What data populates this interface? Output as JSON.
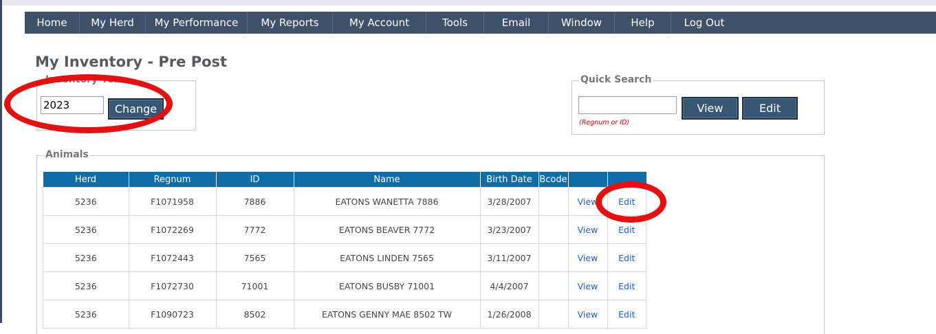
{
  "nav": {
    "items": [
      "Home",
      "My Herd",
      "My Performance",
      "My Reports",
      "My Account",
      "Tools",
      "Email",
      "Window",
      "Help",
      "Log Out"
    ]
  },
  "page": {
    "title": "My Inventory - Pre Post"
  },
  "inventory_year": {
    "legend": "Inventory Year",
    "value": "2023",
    "change_label": "Change"
  },
  "quick_search": {
    "legend": "Quick Search",
    "value": "",
    "view_label": "View",
    "edit_label": "Edit",
    "hint": "(Regnum or ID)"
  },
  "animals": {
    "legend": "Animals",
    "columns": [
      "Herd",
      "Regnum",
      "ID",
      "Name",
      "Birth Date",
      "Bcode",
      "",
      ""
    ],
    "rows": [
      {
        "herd": "5236",
        "regnum": "F1071958",
        "id": "7886",
        "name": "EATONS WANETTA 7886",
        "birth_date": "3/28/2007",
        "bcode": "",
        "view": "View",
        "edit": "Edit"
      },
      {
        "herd": "5236",
        "regnum": "F1072269",
        "id": "7772",
        "name": "EATONS BEAVER 7772",
        "birth_date": "3/23/2007",
        "bcode": "",
        "view": "View",
        "edit": "Edit"
      },
      {
        "herd": "5236",
        "regnum": "F1072443",
        "id": "7565",
        "name": "EATONS LINDEN 7565",
        "birth_date": "3/11/2007",
        "bcode": "",
        "view": "View",
        "edit": "Edit"
      },
      {
        "herd": "5236",
        "regnum": "F1072730",
        "id": "71001",
        "name": "EATONS BUSBY 71001",
        "birth_date": "4/4/2007",
        "bcode": "",
        "view": "View",
        "edit": "Edit"
      },
      {
        "herd": "5236",
        "regnum": "F1090723",
        "id": "8502",
        "name": "EATONS GENNY MAE 8502 TW",
        "birth_date": "1/26/2008",
        "bcode": "",
        "view": "View",
        "edit": "Edit"
      }
    ]
  },
  "colors": {
    "nav_bg": "#3d5269",
    "table_header": "#0f6da8",
    "button_bg": "#385774",
    "link": "#1a5fd0",
    "annotation": "#e31212"
  }
}
